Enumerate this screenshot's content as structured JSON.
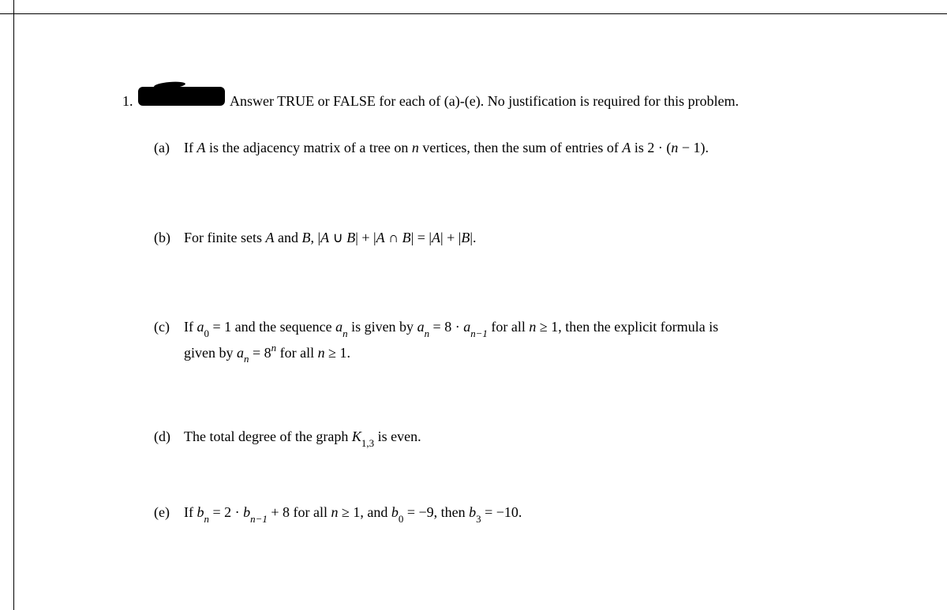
{
  "question": {
    "number": "1.",
    "intro": "Answer TRUE or FALSE for each of (a)-(e). No justification is required for this problem.",
    "parts": {
      "a": {
        "label": "(a)",
        "prefix": "If ",
        "A": "A",
        "mid1": " is the adjacency matrix of a tree on ",
        "n": "n",
        "mid2": " vertices, then the sum of entries of ",
        "A2": "A",
        "mid3": " is 2 · (",
        "n2": "n",
        "tail": " − 1)."
      },
      "b": {
        "label": "(b)",
        "prefix": "For finite sets ",
        "A": "A",
        "and": " and ",
        "B": "B",
        "eq": ", |",
        "A2": "A",
        "cup": " ∪ ",
        "B2": "B",
        "mid": "| + |",
        "A3": "A",
        "cap": " ∩ ",
        "B3": "B",
        "eq2": "| = |",
        "A4": "A",
        "plus": "| + |",
        "B4": "B",
        "tail": "|."
      },
      "c": {
        "label": "(c)",
        "prefix": "If ",
        "a0": "a",
        "sub0": "0",
        "eq1": " = 1 and the sequence ",
        "an": "a",
        "subn": "n",
        "mid1": " is given by ",
        "an2": "a",
        "subn2": "n",
        "eq2": " = 8 · ",
        "an3": "a",
        "subn3": "n−1",
        "mid2": " for all ",
        "n": "n",
        "geq1": " ≥ 1, then the explicit formula is",
        "line2_prefix": "given by ",
        "an4": "a",
        "subn4": "n",
        "eq3": " = 8",
        "supn": "n",
        "mid3": " for all ",
        "n2": "n",
        "tail": " ≥ 1."
      },
      "d": {
        "label": "(d)",
        "prefix": "The total degree of the graph ",
        "K": "K",
        "sub13": "1,3",
        "tail": " is even."
      },
      "e": {
        "label": "(e)",
        "prefix": "If ",
        "bn": "b",
        "subn": "n",
        "eq1": " = 2 · ",
        "bn2": "b",
        "subn2": "n−1",
        "mid1": " + 8 for all ",
        "n": "n",
        "geq": " ≥ 1, and ",
        "b0": "b",
        "sub0": "0",
        "eq2": " = −9, then ",
        "b3": "b",
        "sub3": "3",
        "tail": " = −10."
      }
    }
  }
}
